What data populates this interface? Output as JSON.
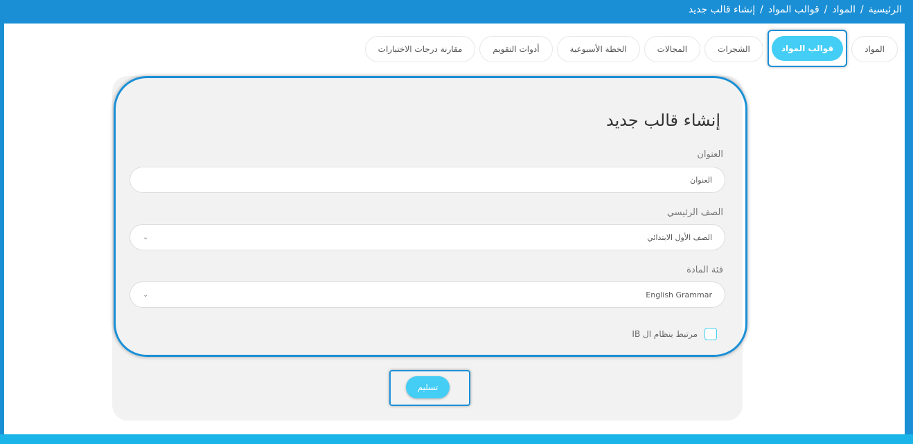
{
  "breadcrumb": {
    "home": "الرئيسية",
    "materials": "المواد",
    "templates": "قوالب المواد",
    "current": "إنشاء قالب جديد",
    "separator": "/"
  },
  "tabs": [
    {
      "label": "المواد",
      "active": false
    },
    {
      "label": "قوالب المواد",
      "active": true
    },
    {
      "label": "الشجرات",
      "active": false
    },
    {
      "label": "المجالات",
      "active": false
    },
    {
      "label": "الخطة الأسبوعية",
      "active": false
    },
    {
      "label": "أدوات التقويم",
      "active": false
    },
    {
      "label": "مقارنة درجات الاختبارات",
      "active": false
    }
  ],
  "form": {
    "title": "إنشاء قالب جديد",
    "title_label": "العنوان",
    "title_placeholder": "العنوان",
    "grade_label": "الصف الرئيسي",
    "grade_value": "الصف الأول الابتدائي",
    "category_label": "فئة المادة",
    "category_value": "English Grammar",
    "ib_label": "مرتبط بنظام ال IB",
    "submit_label": "تسليم"
  },
  "colors": {
    "brand": "#1a8fd6",
    "accent": "#44cdf5",
    "card_bg": "#f2f2f2"
  }
}
